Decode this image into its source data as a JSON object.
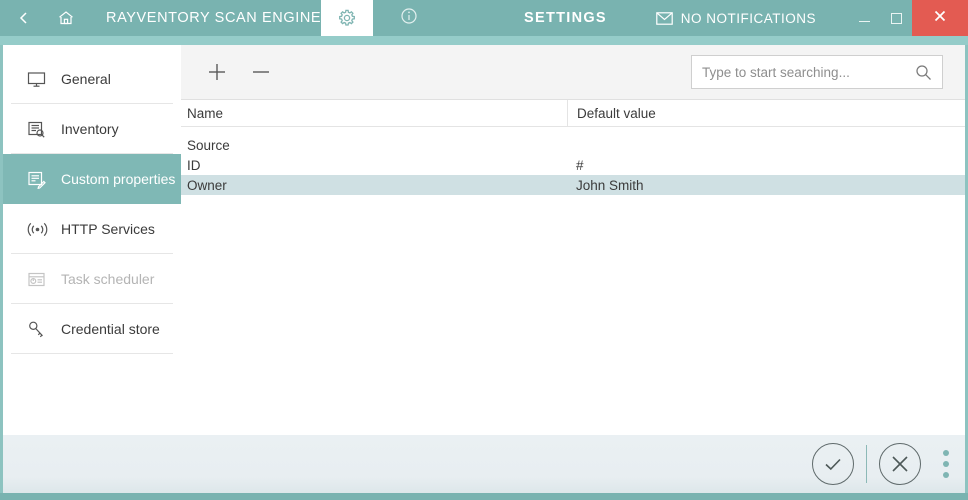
{
  "titlebar": {
    "back_icon": "chevron-left-icon",
    "home_icon": "home-icon",
    "app_name": "RAYVENTORY SCAN ENGINE",
    "settings_tab_icon": "gear-icon",
    "info_tab_icon": "info-icon",
    "page_title": "SETTINGS",
    "notifications_icon": "envelope-icon",
    "notifications_label": "NO NOTIFICATIONS",
    "minimize_label": "Minimize",
    "maximize_label": "Maximize",
    "close_label": "Close"
  },
  "sidebar": {
    "items": [
      {
        "label": "General",
        "icon": "monitor-icon",
        "state": "normal"
      },
      {
        "label": "Inventory",
        "icon": "inventory-icon",
        "state": "normal"
      },
      {
        "label": "Custom properties",
        "icon": "edit-list-icon",
        "state": "active"
      },
      {
        "label": "HTTP Services",
        "icon": "broadcast-icon",
        "state": "normal"
      },
      {
        "label": "Task scheduler",
        "icon": "calendar-clock-icon",
        "state": "disabled"
      },
      {
        "label": "Credential store",
        "icon": "key-icon",
        "state": "normal"
      }
    ]
  },
  "toolbar": {
    "add_icon": "plus-icon",
    "add_label": "Add",
    "remove_icon": "minus-icon",
    "remove_label": "Remove"
  },
  "search": {
    "value": "",
    "placeholder": "Type to start searching...",
    "icon": "search-icon"
  },
  "grid": {
    "columns": [
      "Name",
      "Default value"
    ],
    "rows": [
      {
        "name": "Source",
        "value": "",
        "selected": false
      },
      {
        "name": "ID",
        "value": "#",
        "selected": false
      },
      {
        "name": "Owner",
        "value": "John Smith",
        "selected": true
      }
    ]
  },
  "footer": {
    "accept_icon": "check-circle-icon",
    "accept_label": "Accept",
    "cancel_icon": "close-circle-icon",
    "cancel_label": "Cancel",
    "more_icon": "kebab-menu-icon",
    "more_label": "More options"
  },
  "colors": {
    "teal_header": "#79b3b0",
    "teal_strip": "#95ccc9",
    "accent_active": "#7fb8b5",
    "close_red": "#e35b52",
    "row_selected": "#cfe0e3",
    "footer_bg": "#e9eff2",
    "toolbar_bg": "#f4f4f4"
  }
}
